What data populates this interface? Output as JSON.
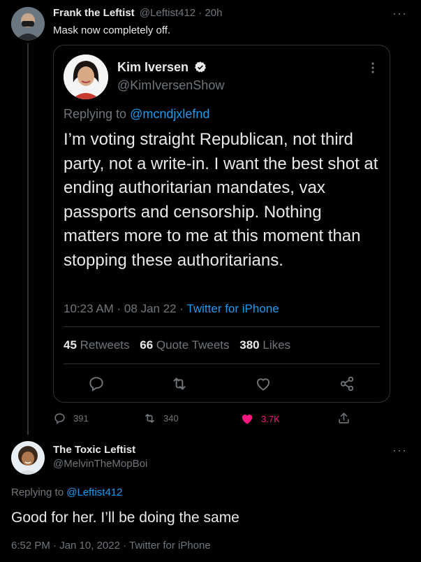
{
  "tweet1": {
    "author_name": "Frank the Leftist",
    "handle_time": "@Leftist412 · 20h",
    "text": "Mask now completely off.",
    "actions": {
      "replies": "391",
      "retweets": "340",
      "likes": "3.7K"
    }
  },
  "quoted": {
    "author_name": "Kim Iversen",
    "handle": "@KimIversenShow",
    "replying_prefix": "Replying to",
    "replying_handle": "@mcndjxlefnd",
    "text": "I’m voting straight Republican, not third party, not a write-in. I want the best shot at ending authoritarian mandates, vax passports and censorship. Nothing matters more to me at this moment than stopping these authoritarians.",
    "meta_time": "10:23 AM · 08 Jan 22 · ",
    "meta_source": "Twitter for iPhone",
    "stats": {
      "retweets_count": "45",
      "retweets_label": "Retweets",
      "quotes_count": "66",
      "quotes_label": "Quote Tweets",
      "likes_count": "380",
      "likes_label": "Likes"
    }
  },
  "tweet2": {
    "author_name": "The Toxic Leftist",
    "handle": "@MelvinTheMopBoi",
    "replying_prefix": "Replying to",
    "replying_handle": "@Leftist412",
    "text": "Good for her. I’ll be doing the same",
    "meta": "6:52 PM · Jan 10, 2022 · Twitter for iPhone"
  },
  "more_glyph": "···",
  "colors": {
    "background": "#000000",
    "accent": "#1d9bf0",
    "like": "#f91880",
    "muted": "#71767b"
  }
}
